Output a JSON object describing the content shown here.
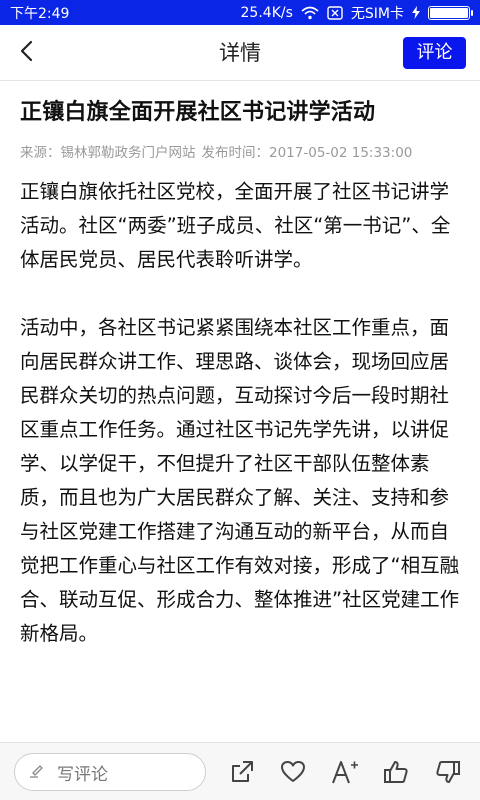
{
  "status_bar": {
    "time": "下午2:49",
    "network_speed": "25.4K/s",
    "sim_status": "无SIM卡",
    "battery_level": 1.0
  },
  "header": {
    "back_icon": "chevron-left-icon",
    "title": "详情",
    "comment_button_label": "评论"
  },
  "article": {
    "title": "正镶白旗全面开展社区书记讲学活动",
    "source": "来源：锡林郭勒政务门户网站",
    "publish_time": "发布时间：2017-05-02 15:33:00",
    "paragraphs": [
      "正镶白旗依托社区党校，全面开展了社区书记讲学活动。社区“两委”班子成员、社区“第一书记”、全体居民党员、居民代表聆听讲学。",
      "活动中，各社区书记紧紧围绕本社区工作重点，面向居民群众讲工作、理思路、谈体会，现场回应居民群众关切的热点问题，互动探讨今后一段时期社区重点工作任务。通过社区书记先学先讲，以讲促学、以学促干，不但提升了社区干部队伍整体素质，而且也为广大居民群众了解、关注、支持和参与社区党建工作搭建了沟通互动的新平台，从而自觉把工作重心与社区工作有效对接，形成了“相互融合、联动互促、形成合力、整体推进”社区党建工作新格局。"
    ]
  },
  "bottom_bar": {
    "comment_placeholder": "写评论",
    "icons": [
      "share-icon",
      "heart-icon",
      "font-size-icon",
      "thumbs-up-icon",
      "thumbs-down-icon"
    ]
  },
  "colors": {
    "accent": "#0a16ee",
    "status_bar": "#0a25e6",
    "meta_text": "#9a9a9a"
  }
}
